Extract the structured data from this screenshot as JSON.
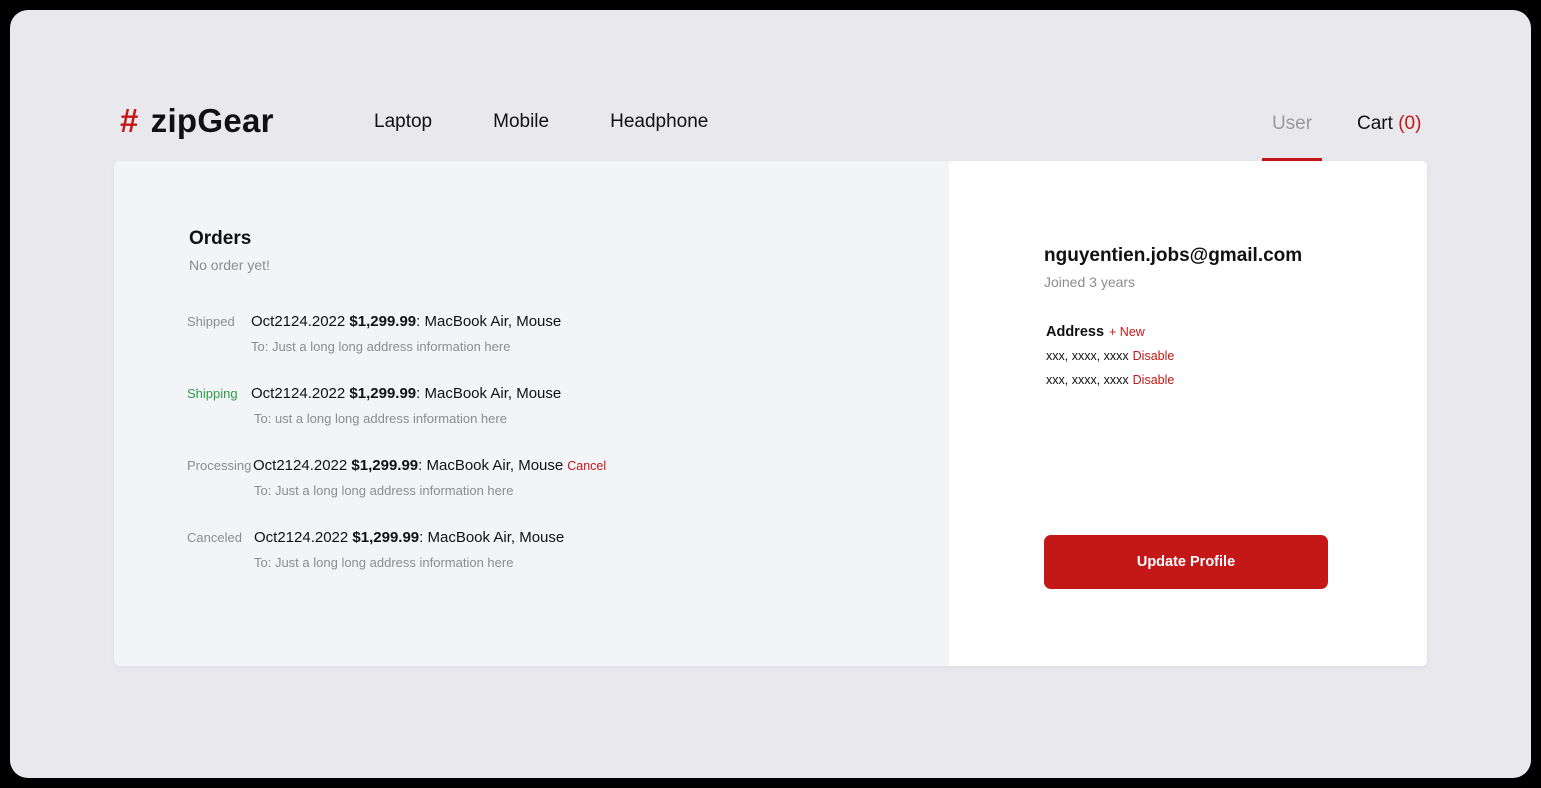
{
  "brand": {
    "symbol": "#",
    "name": "zipGear"
  },
  "nav": {
    "items": [
      "Laptop",
      "Mobile",
      "Headphone"
    ]
  },
  "header": {
    "user_label": "User",
    "cart_label": "Cart",
    "cart_count": "(0)"
  },
  "orders": {
    "title": "Orders",
    "empty_text": "No order yet!",
    "items": [
      {
        "status": "Shipped",
        "date": "Oct2124.2022",
        "amount": "$1,299.99",
        "products": ": MacBook Air, Mouse",
        "address": "To: Just a long long address information here"
      },
      {
        "status": "Shipping",
        "date": "Oct2124.2022",
        "amount": "$1,299.99",
        "products": ": MacBook Air, Mouse",
        "address": "To: ust a long long address information here"
      },
      {
        "status": "Processing",
        "date": "Oct2124.2022",
        "amount": "$1,299.99",
        "products": ": MacBook Air, Mouse",
        "action": "Cancel",
        "address": "To: Just a long long address information here"
      },
      {
        "status": "Canceled",
        "date": "Oct2124.2022",
        "amount": "$1,299.99",
        "products": ": MacBook Air, Mouse",
        "address": "To: Just a long long address information here"
      }
    ]
  },
  "profile": {
    "email": "nguyentien.jobs@gmail.com",
    "joined": "Joined 3 years",
    "address_label": "Address",
    "address_new": "+ New",
    "addresses": [
      {
        "value": "xxx, xxxx, xxxx",
        "action": "Disable"
      },
      {
        "value": "xxx, xxxx, xxxx",
        "action": "Disable"
      }
    ],
    "update_button": "Update Profile"
  },
  "colors": {
    "accent": "#c41717",
    "shipping_green": "#2e9c47",
    "page_bg": "#e9e8ed",
    "left_pane_bg": "#f3f4f8"
  }
}
